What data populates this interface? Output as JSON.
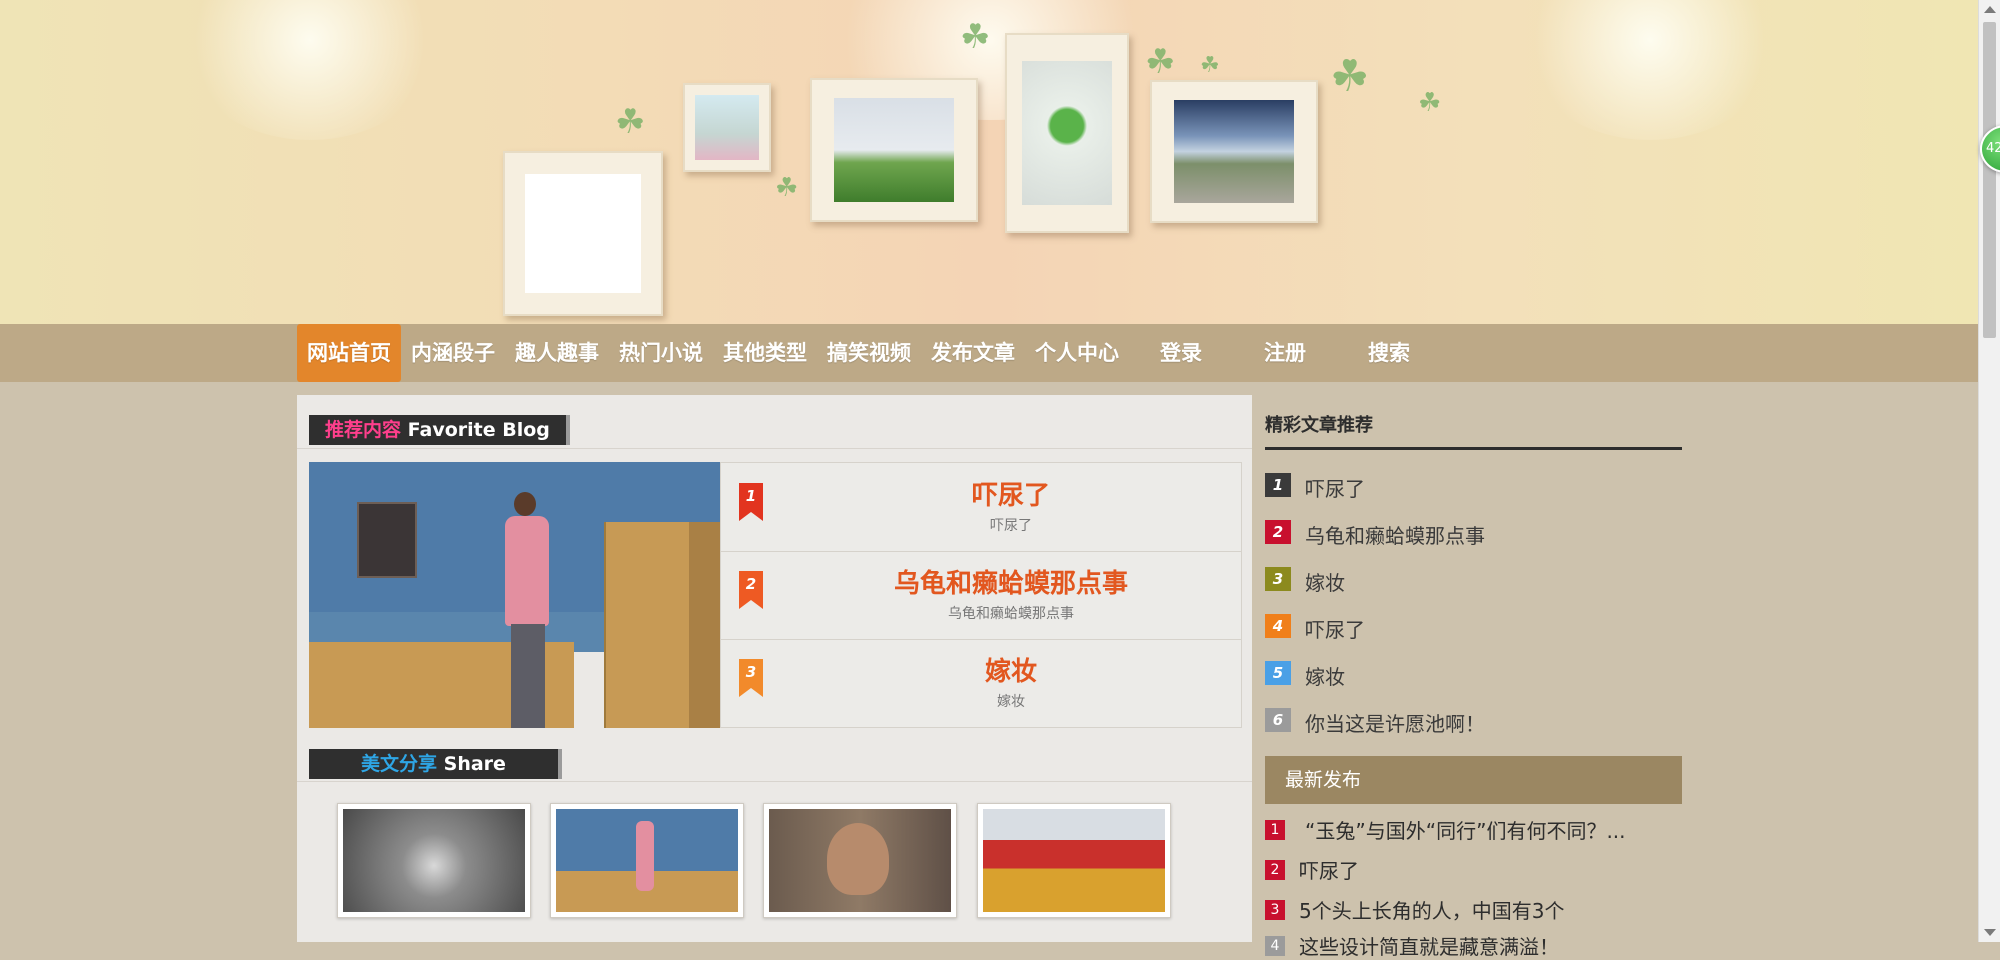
{
  "nav": {
    "items": [
      "网站首页",
      "内涵段子",
      "趣人趣事",
      "热门小说",
      "其他类型",
      "搞笑视频",
      "发布文章",
      "个人中心",
      "登录",
      "注册",
      "搜索"
    ],
    "active_index": 0
  },
  "recommended": {
    "tab_label_cn": "推荐内容",
    "tab_label_en": "Favorite Blog",
    "items": [
      {
        "rank": "1",
        "title": "吓尿了",
        "sub": "吓尿了"
      },
      {
        "rank": "2",
        "title": "乌龟和癞蛤蟆那点事",
        "sub": "乌龟和癞蛤蟆那点事"
      },
      {
        "rank": "3",
        "title": "嫁妆",
        "sub": "嫁妆"
      }
    ]
  },
  "share": {
    "tab_label_cn": "美文分享",
    "tab_label_en": "Share"
  },
  "sidebar": {
    "title": "精彩文章推荐",
    "ranked": [
      {
        "rank": "1",
        "text": "吓尿了",
        "color": "#3a3a3a"
      },
      {
        "rank": "2",
        "text": "乌龟和癞蛤蟆那点事",
        "color": "#c8102e"
      },
      {
        "rank": "3",
        "text": "嫁妆",
        "color": "#8c8a1e"
      },
      {
        "rank": "4",
        "text": "吓尿了",
        "color": "#f07f1a"
      },
      {
        "rank": "5",
        "text": "嫁妆",
        "color": "#4aa0e6"
      },
      {
        "rank": "6",
        "text": "你当这是许愿池啊！",
        "color": "#9b9b9b"
      }
    ],
    "latest_title": "最新发布",
    "latest": [
      {
        "rank": "1",
        "text": "“玉兔”与国外“同行”们有何不同？..."
      },
      {
        "rank": "2",
        "text": "吓尿了"
      },
      {
        "rank": "3",
        "text": "5个头上长角的人，中国有3个"
      },
      {
        "rank": "4",
        "text": "这些设计简直就是藏意满溢！"
      }
    ]
  },
  "float_button": {
    "label": "42"
  },
  "colors": {
    "accent_orange": "#e3862b",
    "nav_bg": "#bda987",
    "page_bg": "#cdc2ad",
    "pink_tag": "#ff3f8c",
    "blue_tag": "#2ea6e6",
    "title_orange": "#e2571f"
  }
}
